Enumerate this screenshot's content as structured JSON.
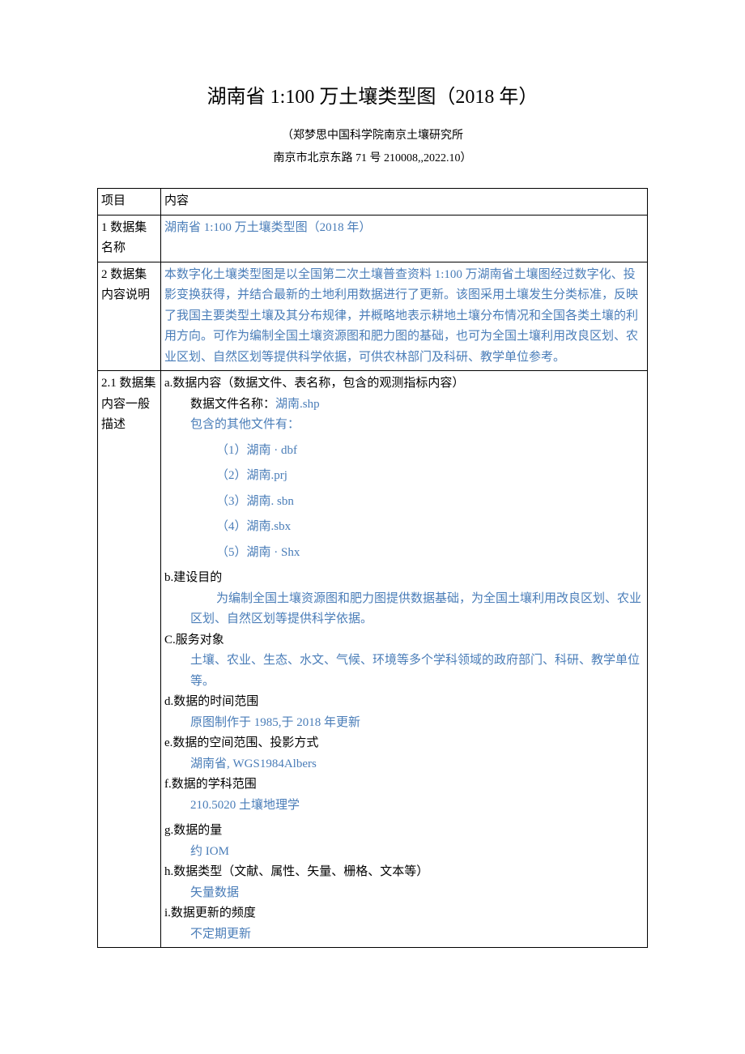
{
  "title": "湖南省 1:100 万土壤类型图（2018 年）",
  "subtitle1": "（郑梦思中国科学院南京土壤研究所",
  "subtitle2": "南京市北京东路 71 号 210008,,2022.10）",
  "headers": {
    "col1": "项目",
    "col2": "内容"
  },
  "row1": {
    "label": "1 数据集名称",
    "value": "湖南省 1:100 万土壤类型图（2018 年）"
  },
  "row2": {
    "label": "2 数据集内容说明",
    "value": "本数字化土壤类型图是以全国第二次土壤普查资料 1:100 万湖南省土壤图经过数字化、投影变换获得，并结合最新的土地利用数据进行了更新。该图采用土壤发生分类标准，反映了我国主要类型土壤及其分布规律，并概略地表示耕地土壤分布情况和全国各类土壤的利用方向。可作为编制全国土壤资源图和肥力图的基础，也可为全国土壤利用改良区划、农业区划、自然区划等提供科学依据，可供农林部门及科研、教学单位参考。"
  },
  "row3": {
    "label": "2.1 数据集内容一般描述",
    "a": {
      "head": "a.数据内容（数据文件、表名称，包含的观测指标内容）",
      "file_label": "数据文件名称：",
      "file_name": "湖南.shp",
      "other_label": "包含的其他文件有：",
      "files": [
        "（1）湖南 · dbf",
        "（2）湖南.prj",
        "（3）湖南. sbn",
        "（4）湖南.sbx",
        "（5）湖南 · Shx"
      ]
    },
    "b": {
      "head": "b.建设目的",
      "text": "为编制全国土壤资源图和肥力图提供数据基础，为全国土壤利用改良区划、农业区划、自然区划等提供科学依据。"
    },
    "c": {
      "head": "C.服务对象",
      "text": "土壤、农业、生态、水文、气候、环境等多个学科领域的政府部门、科研、教学单位等。"
    },
    "d": {
      "head": "d.数据的时间范围",
      "text": "原图制作于 1985,于 2018 年更新"
    },
    "e": {
      "head": "e.数据的空间范围、投影方式",
      "text": "湖南省, WGS1984Albers"
    },
    "f": {
      "head": "f.数据的学科范围",
      "text": "210.5020 土壤地理学"
    },
    "g": {
      "head": "g.数据的量",
      "text": "约 IOM"
    },
    "h": {
      "head": "h.数据类型（文献、属性、矢量、栅格、文本等）",
      "text": "矢量数据"
    },
    "i": {
      "head": "i.数据更新的频度",
      "text": "不定期更新"
    }
  }
}
